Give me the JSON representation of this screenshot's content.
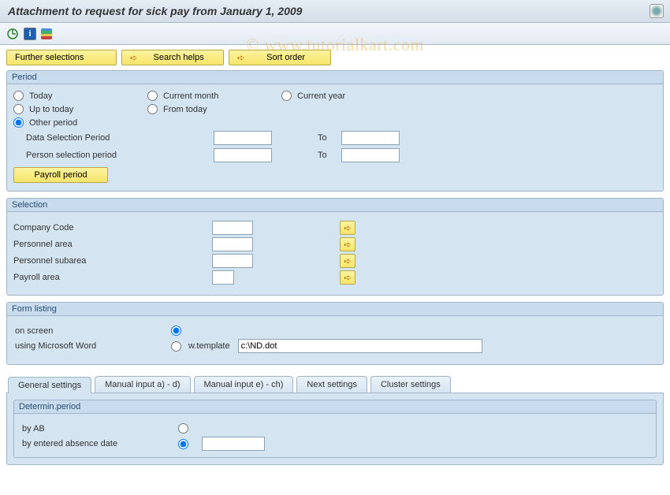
{
  "title": "Attachment to request for sick pay from January 1, 2009",
  "watermark": "© www.tutorialkart.com",
  "toolbar_buttons": {
    "further": "Further selections",
    "search": "Search helps",
    "sort": "Sort order"
  },
  "period": {
    "legend": "Period",
    "today": "Today",
    "current_month": "Current month",
    "current_year": "Current year",
    "up_to_today": "Up to today",
    "from_today": "From today",
    "other": "Other period",
    "data_sel": "Data Selection Period",
    "person_sel": "Person selection period",
    "to": "To",
    "payroll_btn": "Payroll period",
    "data_from": "",
    "data_to": "",
    "person_from": "",
    "person_to": ""
  },
  "selection": {
    "legend": "Selection",
    "company": "Company Code",
    "pers_area": "Personnel area",
    "pers_sub": "Personnel subarea",
    "payroll_area": "Payroll area",
    "company_val": "",
    "pers_area_val": "",
    "pers_sub_val": "",
    "payroll_area_val": ""
  },
  "form_listing": {
    "legend": "Form listing",
    "on_screen": "on screen",
    "using_word": "using Microsoft Word",
    "w_template": "w.template",
    "template_path": "c:\\ND.dot"
  },
  "tabs": {
    "general": "General settings",
    "manual_ad": "Manual input a) - d)",
    "manual_ech": "Manual input e) - ch)",
    "next": "Next settings",
    "cluster": "Cluster settings"
  },
  "determin": {
    "legend": "Determin.period",
    "by_ab": "by AB",
    "by_date": "by entered absence date",
    "date_val": ""
  }
}
